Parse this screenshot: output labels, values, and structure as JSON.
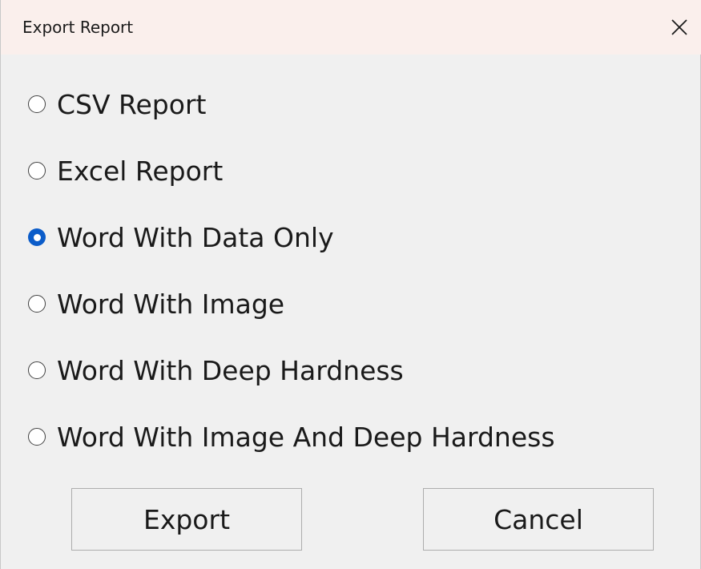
{
  "window": {
    "title": "Export Report",
    "close_icon": "close-icon"
  },
  "options": [
    {
      "label": "CSV Report",
      "checked": false
    },
    {
      "label": "Excel Report",
      "checked": false
    },
    {
      "label": "Word With Data Only",
      "checked": true
    },
    {
      "label": "Word With Image",
      "checked": false
    },
    {
      "label": "Word With Deep Hardness",
      "checked": false
    },
    {
      "label": "Word With Image And Deep Hardness",
      "checked": false
    }
  ],
  "buttons": {
    "export_label": "Export",
    "cancel_label": "Cancel"
  },
  "colors": {
    "titlebar": "#faefec",
    "background": "#f0f0f0",
    "radio_accent": "#0b5cc9"
  }
}
